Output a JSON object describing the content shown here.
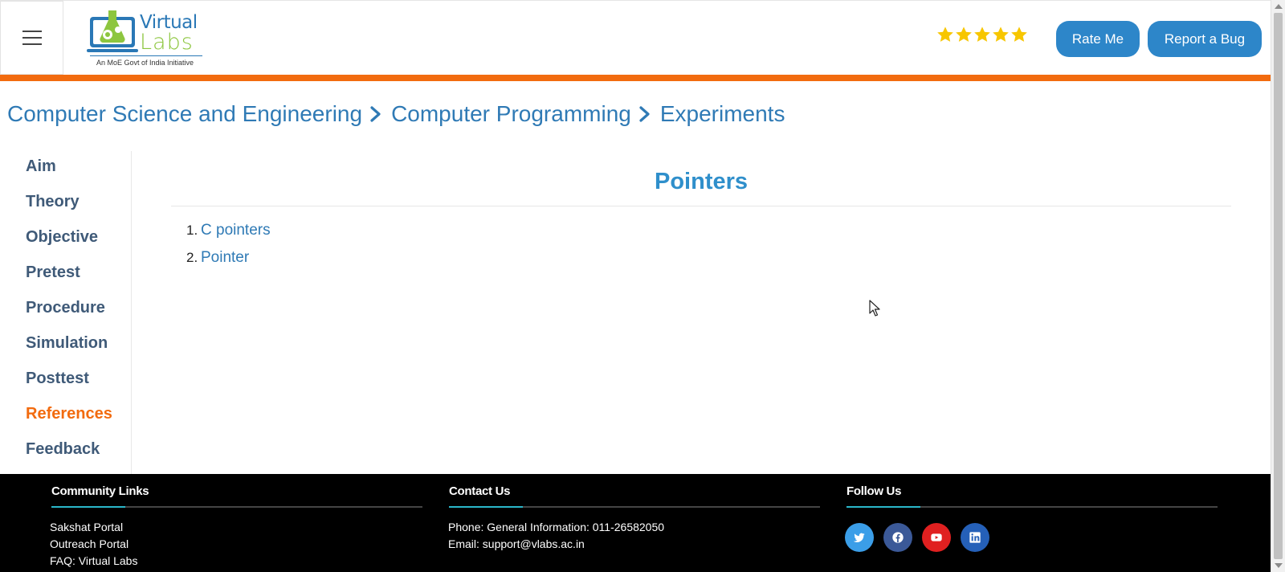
{
  "header": {
    "logo": {
      "brand_top": "Virtual",
      "brand_bottom": "Labs",
      "tagline": "An MoE Govt of India Initiative"
    },
    "rating_stars": 5,
    "rate_button": "Rate Me",
    "bug_button": "Report a Bug",
    "colors": {
      "accent_bar": "#f26b0f",
      "button": "#2d86c9",
      "star": "#f7c600"
    }
  },
  "breadcrumb": {
    "items": [
      "Computer Science and Engineering",
      "Computer Programming",
      "Experiments"
    ]
  },
  "sidebar": {
    "items": [
      {
        "label": "Aim"
      },
      {
        "label": "Theory"
      },
      {
        "label": "Objective"
      },
      {
        "label": "Pretest"
      },
      {
        "label": "Procedure"
      },
      {
        "label": "Simulation"
      },
      {
        "label": "Posttest"
      },
      {
        "label": "References",
        "active": true
      },
      {
        "label": "Feedback"
      }
    ]
  },
  "main": {
    "title": "Pointers",
    "references": [
      {
        "num": "1.",
        "label": "C pointers"
      },
      {
        "num": "2.",
        "label": "Pointer"
      }
    ]
  },
  "footer": {
    "community": {
      "heading": "Community Links",
      "links": [
        "Sakshat Portal",
        "Outreach Portal",
        "FAQ: Virtual Labs"
      ]
    },
    "contact": {
      "heading": "Contact Us",
      "phone": "Phone: General Information: 011-26582050",
      "email": "Email: support@vlabs.ac.in"
    },
    "follow": {
      "heading": "Follow Us",
      "icons": [
        "twitter-icon",
        "facebook-icon",
        "youtube-icon",
        "linkedin-icon"
      ]
    }
  }
}
